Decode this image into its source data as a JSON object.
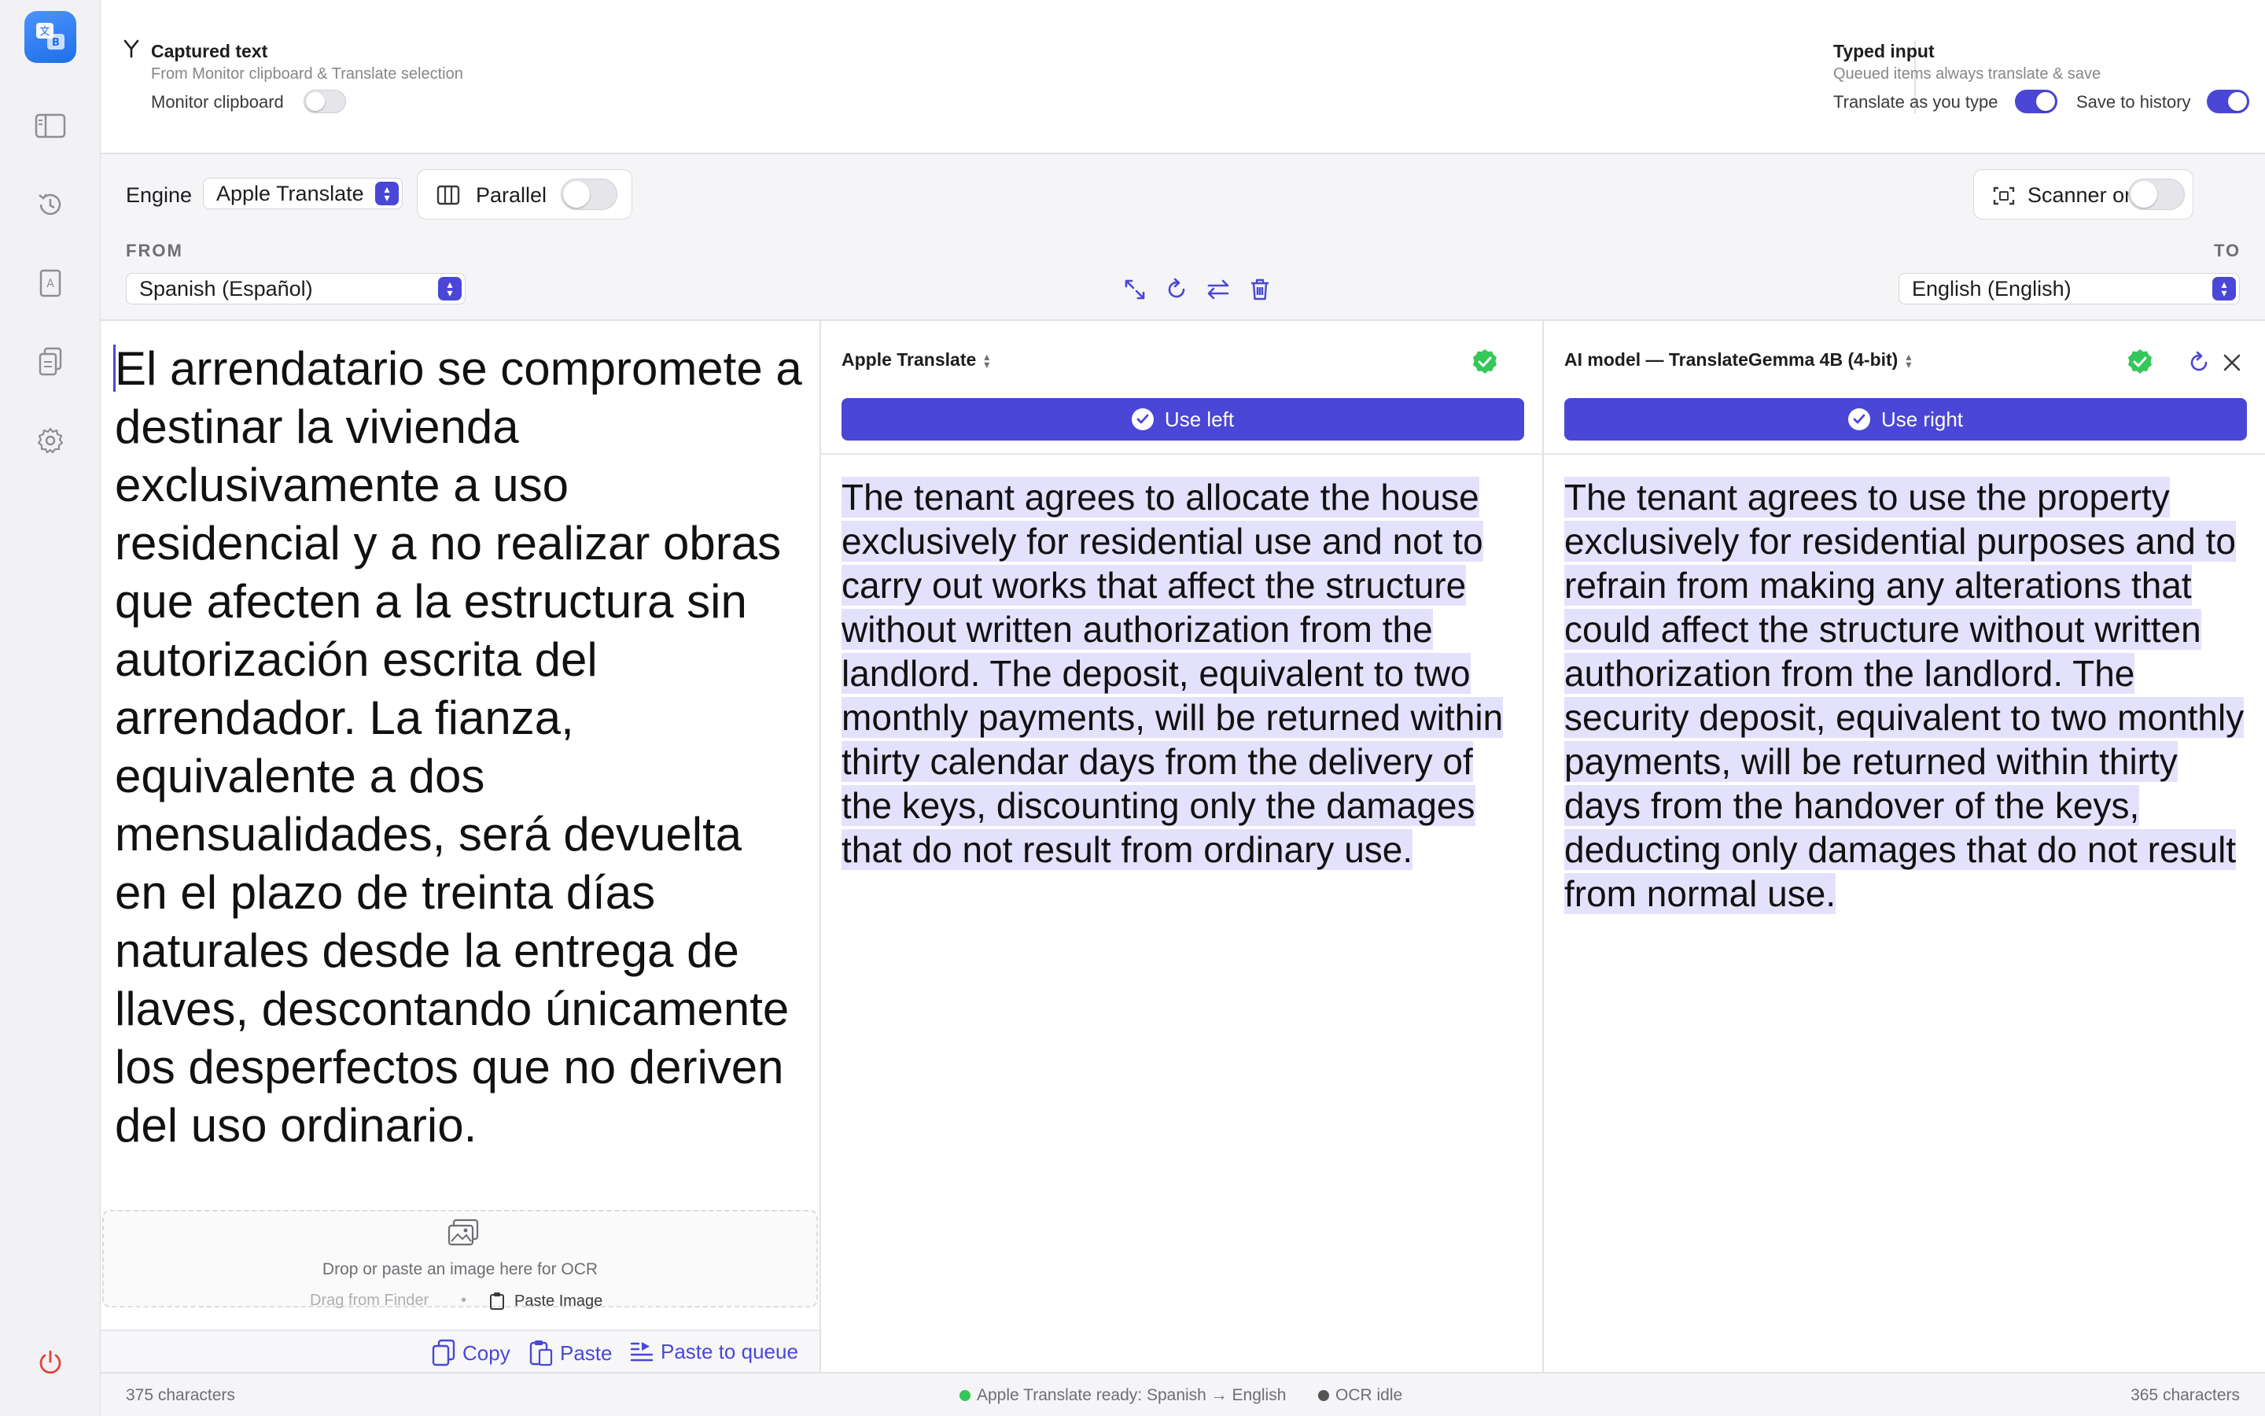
{
  "capture": {
    "title": "Captured text",
    "subtitle": "From Monitor clipboard & Translate selection",
    "monitor_label": "Monitor clipboard",
    "monitor_on": false
  },
  "typed": {
    "title": "Typed input",
    "subtitle": "Queued items always translate & save",
    "translate_label": "Translate as you type",
    "translate_on": true,
    "history_label": "Save to history",
    "history_on": true
  },
  "toolbar": {
    "engine_label": "Engine",
    "engine_value": "Apple Translate",
    "parallel_label": "Parallel",
    "parallel_on": false,
    "scanner_label": "Scanner only",
    "scanner_on": false,
    "from_label": "FROM",
    "to_label": "TO",
    "from_value": "Spanish (Español)",
    "to_value": "English (English)"
  },
  "source": {
    "text": "El arrendatario se compromete a destinar la vivienda exclusivamente a uso residencial y a no realizar obras que afecten a la estructura sin autorización escrita del arrendador. La fianza, equivalente a dos mensualidades, será devuelta en el plazo de treinta días naturales desde la entrega de llaves, descontando únicamente los desperfectos que no deriven del uso ordinario.",
    "ocr_drop": "Drop or paste an image here for OCR",
    "ocr_drag": "Drag from Finder",
    "ocr_sep": "•",
    "ocr_paste": "Paste Image",
    "copy": "Copy",
    "paste": "Paste",
    "paste_queue": "Paste to queue"
  },
  "left": {
    "engine": "Apple Translate",
    "use_label": "Use left",
    "text": "The tenant agrees to allocate the house exclusively for residential use and not to carry out works that affect the structure without written authorization from the landlord. The deposit, equivalent to two monthly payments, will be returned within thirty calendar days from the delivery of the keys, discounting only the damages that do not result from ordinary use."
  },
  "right": {
    "engine": "AI model — TranslateGemma 4B (4-bit)",
    "use_label": "Use right",
    "text": "The tenant agrees to use the property exclusively for residential purposes and to refrain from making any alterations that could affect the structure without written authorization from the landlord. The security deposit, equivalent to two monthly payments, will be returned within thirty days from the handover of the keys, deducting only damages that do not result from normal use."
  },
  "status": {
    "src_count": "375 characters",
    "engine_status": "Apple Translate ready: Spanish → English",
    "ocr_status": "OCR idle",
    "dst_count": "365 characters"
  },
  "colors": {
    "accent": "#4a47d6",
    "ok": "#34c759",
    "power": "#e0443a"
  }
}
